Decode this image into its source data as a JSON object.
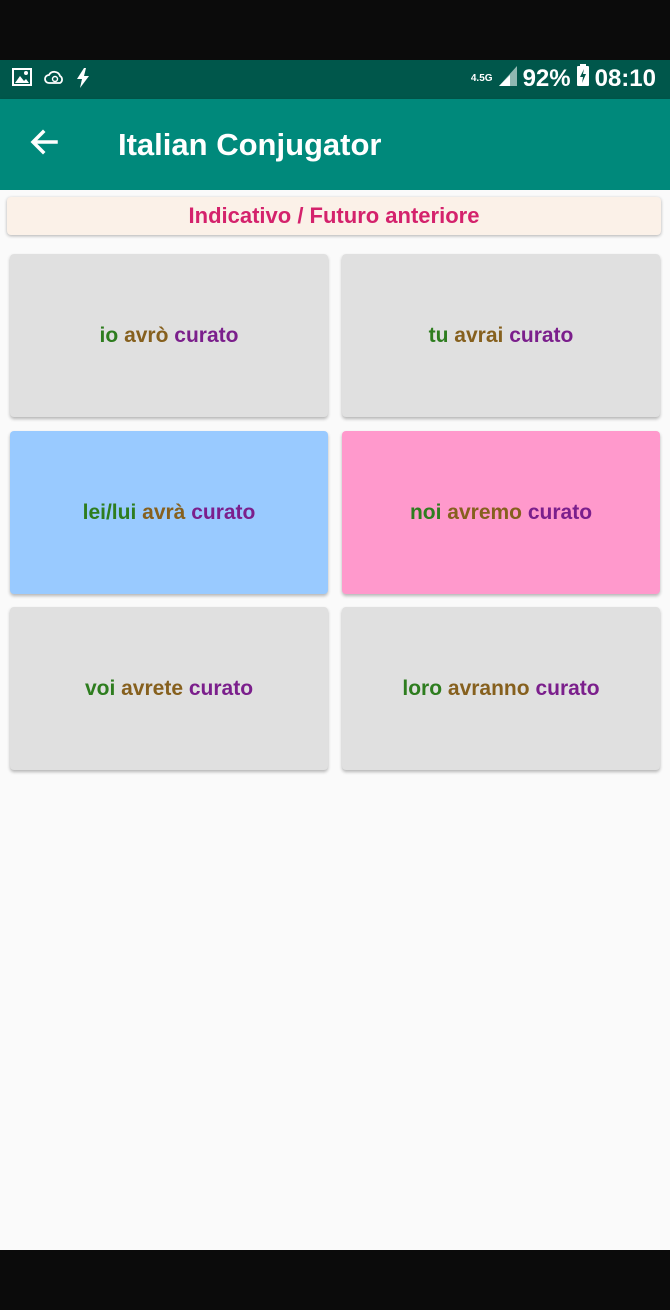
{
  "status_bar": {
    "network": "4.5G",
    "battery": "92%",
    "time": "08:10",
    "icons": [
      "image-icon",
      "cloud-sync-icon",
      "flash-icon",
      "signal-icon",
      "battery-charging-icon"
    ]
  },
  "app_bar": {
    "title": "Italian Conjugator",
    "back_icon": "back-arrow-icon"
  },
  "tense": "Indicativo / Futuro anteriore",
  "colors": {
    "app_bar": "#00897b",
    "status_bar": "#00574b",
    "tense_text": "#d4226c",
    "pronoun": "#2e7d1f",
    "auxiliary": "#86601e",
    "participle": "#7b1f8c",
    "card_default": "#e0e0e0",
    "card_blue": "#99caff",
    "card_pink": "#ff99cc"
  },
  "cards": [
    {
      "pronoun": "io",
      "auxiliary": "avrò",
      "participle": "curato",
      "bg": "#e0e0e0"
    },
    {
      "pronoun": "tu",
      "auxiliary": "avrai",
      "participle": "curato",
      "bg": "#e0e0e0"
    },
    {
      "pronoun": "lei/lui",
      "auxiliary": "avrà",
      "participle": "curato",
      "bg": "#99caff"
    },
    {
      "pronoun": "noi",
      "auxiliary": "avremo",
      "participle": "curato",
      "bg": "#ff99cc"
    },
    {
      "pronoun": "voi",
      "auxiliary": "avrete",
      "participle": "curato",
      "bg": "#e0e0e0"
    },
    {
      "pronoun": "loro",
      "auxiliary": "avranno",
      "participle": "curato",
      "bg": "#e0e0e0"
    }
  ]
}
